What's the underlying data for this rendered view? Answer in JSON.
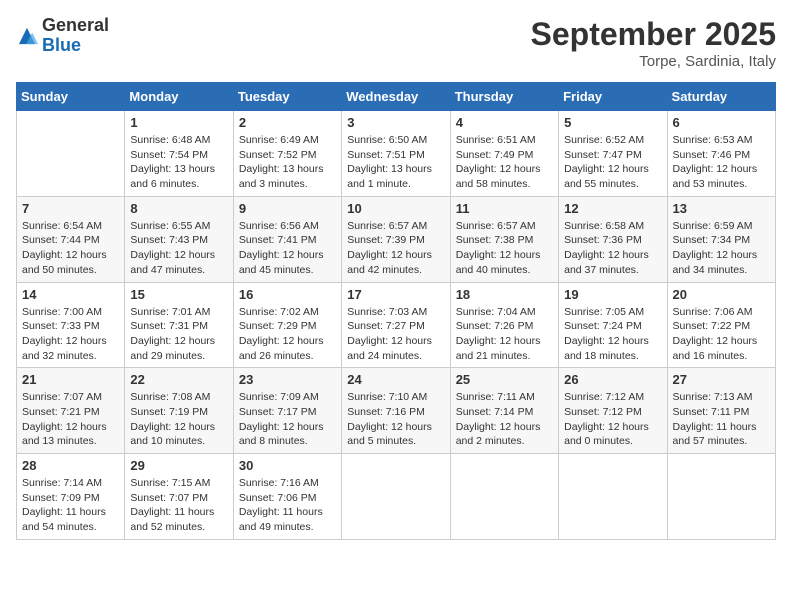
{
  "header": {
    "logo_general": "General",
    "logo_blue": "Blue",
    "month_title": "September 2025",
    "location": "Torpe, Sardinia, Italy"
  },
  "weekdays": [
    "Sunday",
    "Monday",
    "Tuesday",
    "Wednesday",
    "Thursday",
    "Friday",
    "Saturday"
  ],
  "weeks": [
    [
      {
        "day": "",
        "sunrise": "",
        "sunset": "",
        "daylight": ""
      },
      {
        "day": "1",
        "sunrise": "Sunrise: 6:48 AM",
        "sunset": "Sunset: 7:54 PM",
        "daylight": "Daylight: 13 hours and 6 minutes."
      },
      {
        "day": "2",
        "sunrise": "Sunrise: 6:49 AM",
        "sunset": "Sunset: 7:52 PM",
        "daylight": "Daylight: 13 hours and 3 minutes."
      },
      {
        "day": "3",
        "sunrise": "Sunrise: 6:50 AM",
        "sunset": "Sunset: 7:51 PM",
        "daylight": "Daylight: 13 hours and 1 minute."
      },
      {
        "day": "4",
        "sunrise": "Sunrise: 6:51 AM",
        "sunset": "Sunset: 7:49 PM",
        "daylight": "Daylight: 12 hours and 58 minutes."
      },
      {
        "day": "5",
        "sunrise": "Sunrise: 6:52 AM",
        "sunset": "Sunset: 7:47 PM",
        "daylight": "Daylight: 12 hours and 55 minutes."
      },
      {
        "day": "6",
        "sunrise": "Sunrise: 6:53 AM",
        "sunset": "Sunset: 7:46 PM",
        "daylight": "Daylight: 12 hours and 53 minutes."
      }
    ],
    [
      {
        "day": "7",
        "sunrise": "Sunrise: 6:54 AM",
        "sunset": "Sunset: 7:44 PM",
        "daylight": "Daylight: 12 hours and 50 minutes."
      },
      {
        "day": "8",
        "sunrise": "Sunrise: 6:55 AM",
        "sunset": "Sunset: 7:43 PM",
        "daylight": "Daylight: 12 hours and 47 minutes."
      },
      {
        "day": "9",
        "sunrise": "Sunrise: 6:56 AM",
        "sunset": "Sunset: 7:41 PM",
        "daylight": "Daylight: 12 hours and 45 minutes."
      },
      {
        "day": "10",
        "sunrise": "Sunrise: 6:57 AM",
        "sunset": "Sunset: 7:39 PM",
        "daylight": "Daylight: 12 hours and 42 minutes."
      },
      {
        "day": "11",
        "sunrise": "Sunrise: 6:57 AM",
        "sunset": "Sunset: 7:38 PM",
        "daylight": "Daylight: 12 hours and 40 minutes."
      },
      {
        "day": "12",
        "sunrise": "Sunrise: 6:58 AM",
        "sunset": "Sunset: 7:36 PM",
        "daylight": "Daylight: 12 hours and 37 minutes."
      },
      {
        "day": "13",
        "sunrise": "Sunrise: 6:59 AM",
        "sunset": "Sunset: 7:34 PM",
        "daylight": "Daylight: 12 hours and 34 minutes."
      }
    ],
    [
      {
        "day": "14",
        "sunrise": "Sunrise: 7:00 AM",
        "sunset": "Sunset: 7:33 PM",
        "daylight": "Daylight: 12 hours and 32 minutes."
      },
      {
        "day": "15",
        "sunrise": "Sunrise: 7:01 AM",
        "sunset": "Sunset: 7:31 PM",
        "daylight": "Daylight: 12 hours and 29 minutes."
      },
      {
        "day": "16",
        "sunrise": "Sunrise: 7:02 AM",
        "sunset": "Sunset: 7:29 PM",
        "daylight": "Daylight: 12 hours and 26 minutes."
      },
      {
        "day": "17",
        "sunrise": "Sunrise: 7:03 AM",
        "sunset": "Sunset: 7:27 PM",
        "daylight": "Daylight: 12 hours and 24 minutes."
      },
      {
        "day": "18",
        "sunrise": "Sunrise: 7:04 AM",
        "sunset": "Sunset: 7:26 PM",
        "daylight": "Daylight: 12 hours and 21 minutes."
      },
      {
        "day": "19",
        "sunrise": "Sunrise: 7:05 AM",
        "sunset": "Sunset: 7:24 PM",
        "daylight": "Daylight: 12 hours and 18 minutes."
      },
      {
        "day": "20",
        "sunrise": "Sunrise: 7:06 AM",
        "sunset": "Sunset: 7:22 PM",
        "daylight": "Daylight: 12 hours and 16 minutes."
      }
    ],
    [
      {
        "day": "21",
        "sunrise": "Sunrise: 7:07 AM",
        "sunset": "Sunset: 7:21 PM",
        "daylight": "Daylight: 12 hours and 13 minutes."
      },
      {
        "day": "22",
        "sunrise": "Sunrise: 7:08 AM",
        "sunset": "Sunset: 7:19 PM",
        "daylight": "Daylight: 12 hours and 10 minutes."
      },
      {
        "day": "23",
        "sunrise": "Sunrise: 7:09 AM",
        "sunset": "Sunset: 7:17 PM",
        "daylight": "Daylight: 12 hours and 8 minutes."
      },
      {
        "day": "24",
        "sunrise": "Sunrise: 7:10 AM",
        "sunset": "Sunset: 7:16 PM",
        "daylight": "Daylight: 12 hours and 5 minutes."
      },
      {
        "day": "25",
        "sunrise": "Sunrise: 7:11 AM",
        "sunset": "Sunset: 7:14 PM",
        "daylight": "Daylight: 12 hours and 2 minutes."
      },
      {
        "day": "26",
        "sunrise": "Sunrise: 7:12 AM",
        "sunset": "Sunset: 7:12 PM",
        "daylight": "Daylight: 12 hours and 0 minutes."
      },
      {
        "day": "27",
        "sunrise": "Sunrise: 7:13 AM",
        "sunset": "Sunset: 7:11 PM",
        "daylight": "Daylight: 11 hours and 57 minutes."
      }
    ],
    [
      {
        "day": "28",
        "sunrise": "Sunrise: 7:14 AM",
        "sunset": "Sunset: 7:09 PM",
        "daylight": "Daylight: 11 hours and 54 minutes."
      },
      {
        "day": "29",
        "sunrise": "Sunrise: 7:15 AM",
        "sunset": "Sunset: 7:07 PM",
        "daylight": "Daylight: 11 hours and 52 minutes."
      },
      {
        "day": "30",
        "sunrise": "Sunrise: 7:16 AM",
        "sunset": "Sunset: 7:06 PM",
        "daylight": "Daylight: 11 hours and 49 minutes."
      },
      {
        "day": "",
        "sunrise": "",
        "sunset": "",
        "daylight": ""
      },
      {
        "day": "",
        "sunrise": "",
        "sunset": "",
        "daylight": ""
      },
      {
        "day": "",
        "sunrise": "",
        "sunset": "",
        "daylight": ""
      },
      {
        "day": "",
        "sunrise": "",
        "sunset": "",
        "daylight": ""
      }
    ]
  ]
}
